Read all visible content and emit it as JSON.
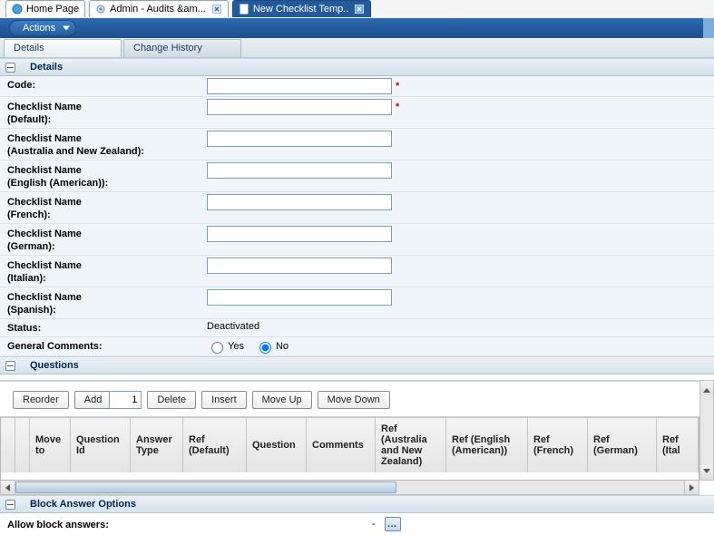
{
  "tabs": {
    "home": {
      "label": "Home Page"
    },
    "admin": {
      "label": "Admin - Audits &am..."
    },
    "active": {
      "label": "New Checklist Temp.."
    }
  },
  "actionbar": {
    "actions_label": "Actions"
  },
  "subtabs": {
    "details": "Details",
    "history": "Change History"
  },
  "sections": {
    "details": "Details",
    "questions": "Questions",
    "block": "Block Answer Options"
  },
  "form": {
    "code_label": "Code:",
    "name_default_label1": "Checklist Name",
    "name_default_label2": "(Default):",
    "name_anz_label1": "Checklist Name",
    "name_anz_label2": "(Australia and New Zealand):",
    "name_enus_label1": "Checklist Name",
    "name_enus_label2": "(English (American)):",
    "name_fr_label1": "Checklist Name",
    "name_fr_label2": "(French):",
    "name_de_label1": "Checklist Name",
    "name_de_label2": "(German):",
    "name_it_label1": "Checklist Name",
    "name_it_label2": "(Italian):",
    "name_es_label1": "Checklist Name",
    "name_es_label2": "(Spanish):",
    "status_label": "Status:",
    "status_value": "Deactivated",
    "general_comments_label": "General Comments:",
    "yes_label": "Yes",
    "no_label": "No"
  },
  "questions_toolbar": {
    "reorder": "Reorder",
    "add": "Add",
    "add_count": "1",
    "delete": "Delete",
    "insert": "Insert",
    "moveup": "Move Up",
    "movedown": "Move Down"
  },
  "questions_columns": {
    "blank1": "",
    "blank2": "",
    "move_to": "Move to",
    "qid": "Question Id",
    "atype": "Answer Type",
    "ref_default": "Ref (Default)",
    "question": "Question",
    "comments": "Comments",
    "ref_anz": "Ref (Australia and New Zealand)",
    "ref_enus": "Ref (English (American))",
    "ref_fr": "Ref (French)",
    "ref_de": "Ref (German)",
    "ref_it": "Ref (Ital"
  },
  "block": {
    "allow_label": "Allow block answers:",
    "value_dash": "-"
  }
}
